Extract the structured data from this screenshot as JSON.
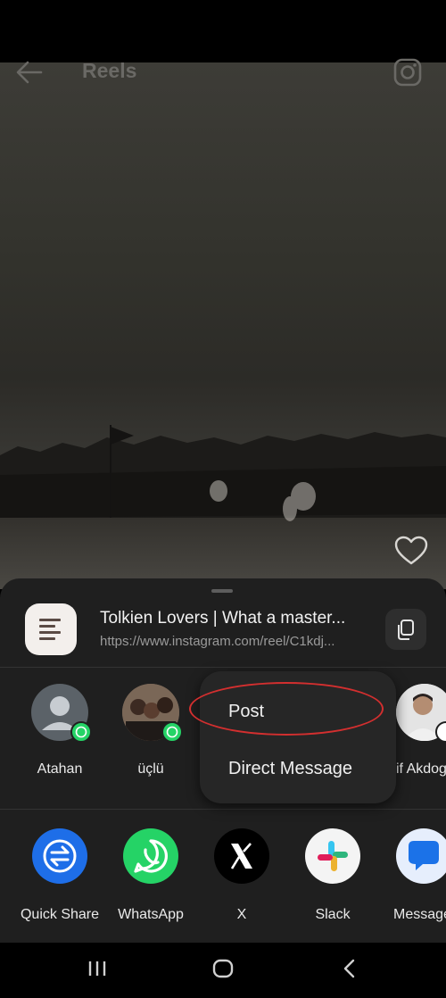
{
  "header": {
    "title": "Reels",
    "back_icon": "arrow-left-icon",
    "camera_icon": "camera-icon"
  },
  "reel": {
    "like_icon": "heart-icon"
  },
  "share_sheet": {
    "link": {
      "title": "Tolkien Lovers | What a master...",
      "url": "https://www.instagram.com/reel/C1kdj..."
    },
    "contacts": [
      {
        "name": "Atahan",
        "badge": "whatsapp-icon"
      },
      {
        "name": "üçlü",
        "badge": "whatsapp-icon"
      },
      {
        "name": "if Akdog",
        "badge": "slack-icon"
      }
    ],
    "apps": [
      {
        "label": "Quick Share",
        "icon": "quick-share-icon",
        "color": "#1e6ee8"
      },
      {
        "label": "WhatsApp",
        "icon": "whatsapp-icon",
        "color": "#25d366"
      },
      {
        "label": "X",
        "icon": "x-icon",
        "color": "#000000"
      },
      {
        "label": "Slack",
        "icon": "slack-icon",
        "color": "#f4f4f4"
      },
      {
        "label": "Message",
        "icon": "messages-icon",
        "color": "#e6eefc"
      }
    ]
  },
  "popup_menu": {
    "items": [
      "Post",
      "Direct Message"
    ]
  },
  "colors": {
    "annotation_highlight": "#d32f2f",
    "sheet_background": "#1f1f1f"
  }
}
